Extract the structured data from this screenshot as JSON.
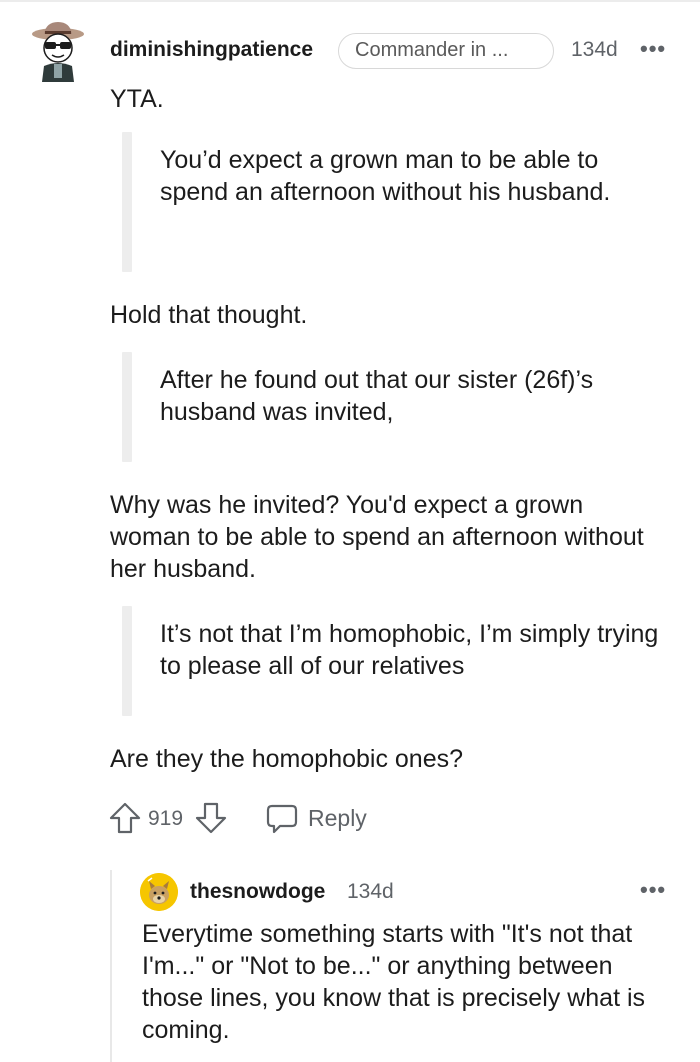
{
  "comment": {
    "username": "diminishingpatience",
    "flair": "Commander in ...",
    "timestamp": "134d",
    "more_icon": "more-dots-icon",
    "paragraphs": {
      "p1": "YTA.",
      "q1": "You’d expect a grown man to be able to spend an afternoon without his husband.",
      "p2": "Hold that thought.",
      "q2": "After he found out that our sister (26f)’s husband was invited,",
      "p3": "Why was he invited? You'd expect a grown woman to be able to spend an afternoon without her husband.",
      "q3": "It’s not that I’m homophobic, I’m simply trying to please all of our relatives",
      "p4": "Are they the homophobic ones?"
    },
    "score": "919",
    "reply_label": "Reply"
  },
  "reply": {
    "username": "thesnowdoge",
    "timestamp": "134d",
    "body": "Everytime something starts with \"It's not that I'm...\" or \"Not to be...\" or anything between those lines, you know that is precisely what is coming."
  },
  "colors": {
    "text": "#1c1c1c",
    "meta": "#5f6368",
    "quote_bar": "#ededed",
    "reply_avatar": "#f6c600"
  }
}
